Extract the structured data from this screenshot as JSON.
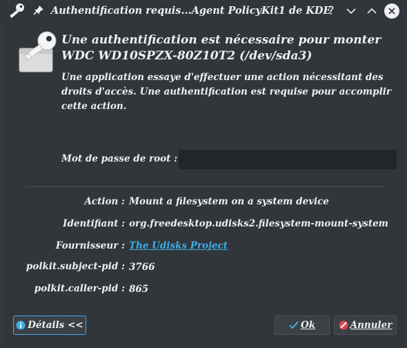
{
  "window": {
    "title": "Authentification requis...Agent PolicyKit1 de KDE",
    "buttons": {
      "help": "?",
      "minimize": "minimize",
      "maximize": "maximize",
      "close": "close"
    }
  },
  "header": {
    "icon": "key-icon",
    "title": "Une authentification est nécessaire pour monter WDC WD10SPZX-80Z10T2 (/dev/sda3)",
    "description": "Une application essaye d'effectuer une action nécessitant des droits d'accès. Une authentification est requise pour accomplir cette action."
  },
  "password": {
    "label": "Mot de passe de root :",
    "value": ""
  },
  "details": {
    "rows": [
      {
        "label": "Action :",
        "value": "Mount a filesystem on a system device"
      },
      {
        "label": "Identifiant :",
        "value": "org.freedesktop.udisks2.filesystem-mount-system"
      },
      {
        "label": "Fournisseur :",
        "value": "The Udisks Project",
        "is_link": true
      },
      {
        "label": "polkit.subject-pid :",
        "value": "3766"
      },
      {
        "label": "polkit.caller-pid :",
        "value": "865"
      }
    ]
  },
  "buttons": {
    "details": {
      "label": "Détails <<",
      "icon": "info-icon"
    },
    "ok": {
      "label": "Ok",
      "icon": "checkmark-icon"
    },
    "cancel": {
      "label": "Annuler",
      "icon": "cancel-icon"
    }
  },
  "colors": {
    "background": "#31363b",
    "text": "#eff0f1",
    "link": "#3daee9",
    "focus": "#3daee9"
  }
}
